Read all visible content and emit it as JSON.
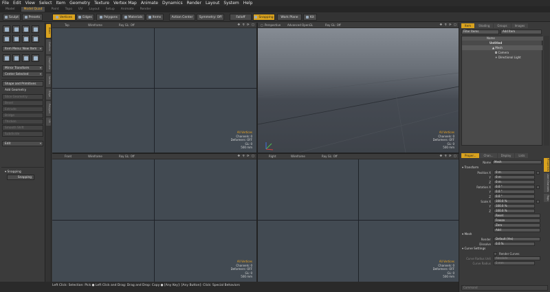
{
  "menu": [
    "File",
    "Edit",
    "View",
    "Select",
    "Item",
    "Geometry",
    "Texture",
    "Vertex Map",
    "Animate",
    "Dynamics",
    "Render",
    "Layout",
    "System",
    "Help"
  ],
  "layout_tabs": [
    {
      "label": "Model",
      "active": false
    },
    {
      "label": "Model Quad",
      "active": true
    },
    {
      "label": "Paint",
      "active": false
    },
    {
      "label": "Topo",
      "active": false
    },
    {
      "label": "UV",
      "active": false
    },
    {
      "label": "Layout",
      "active": false
    },
    {
      "label": "Setup",
      "active": false
    },
    {
      "label": "Animate",
      "active": false
    },
    {
      "label": "Render",
      "active": false
    }
  ],
  "toolbar": {
    "sculpt": "Sculpt",
    "presets": "Presets",
    "vertices": "Vertices",
    "edges": "Edges",
    "polygons": "Polygons",
    "materials": "Materials",
    "items": "Items",
    "action_center": "Action Center",
    "symmetry": "Symmetry: Off",
    "falloff": "Falloff",
    "snapping": "Snapping",
    "work_plane": "Work Plane",
    "kit": "Kit"
  },
  "left": {
    "tabs": [
      "Basic",
      "Deform",
      "Duplicate",
      "Vertex",
      "Edge",
      "Polygon",
      "UV"
    ],
    "item_menu": "Item Menu: New Item",
    "mirror": "Mirror Transform",
    "center": "Center Selected",
    "shape": "Shape and Primitives",
    "add_geometry": "Add Geometry",
    "tools": [
      "Slice Geometry",
      "Bevel",
      "Extrude",
      "Bridge",
      "Thicken",
      "Smooth Shift",
      "Subdivide"
    ],
    "edit": "Edit",
    "snapping_header": "Snapping",
    "snapping_value": "Snapping"
  },
  "viewports": [
    {
      "name": "Top",
      "mode": "Wireframe",
      "render": "Ray GL: Off"
    },
    {
      "name": "Perspective",
      "mode": "Advanced OpenGL",
      "render": "Ray GL: Off"
    },
    {
      "name": "Front",
      "mode": "Wireframe",
      "render": "Ray GL: Off"
    },
    {
      "name": "Right",
      "mode": "Wireframe",
      "render": "Ray GL: Off"
    }
  ],
  "viewport_info": {
    "all": "All Vertices",
    "channels": "Channels: 0",
    "deformers": "Deformers: OFF",
    "gl": "GL: 0",
    "size": "500 mm"
  },
  "viewport_controls": "✥ ⚲ ⟳ ▢",
  "status": "Left Click: Selection: Pick ● Left Click and Drag: Drag and Drop: Copy ● [Any Key]: [Any Button]: Click: Special Behaviors",
  "right": {
    "top_tabs": [
      "Item",
      "Shading",
      "Groups",
      "Images"
    ],
    "filter": "Filter Items",
    "add_item": "Add Item",
    "name_col": "Name",
    "tree": [
      "Untitled",
      "Mesh",
      "Camera",
      "Directional Light"
    ],
    "props_tabs": [
      "Proper...",
      "Chan...",
      "Display",
      "Lists"
    ],
    "name_label": "Name",
    "name_value": "Mesh",
    "transform_header": "Transform",
    "position_label": "Position X",
    "rotation_label": "Rotation X",
    "scale_label": "Scale X",
    "y_label": "Y",
    "z_label": "Z",
    "pos": [
      "0 m",
      "0 m",
      "0 m"
    ],
    "rot": [
      "0.0 °",
      "0.0 °",
      "0.0 °"
    ],
    "scale": [
      "100.0 %",
      "100.0 %",
      "100.0 %"
    ],
    "ops": [
      "Reset",
      "Freeze",
      "Zero",
      "Add"
    ],
    "mesh_header": "Mesh",
    "render_label": "Render",
    "render_value": "Default (Yes)",
    "dissolve_label": "Dissolve",
    "dissolve_value": "0.0 %",
    "curve_header": "Curve Settings",
    "render_curves": "Render Curves",
    "curve_radius_unit": "Curve Radius Unit",
    "curve_radius_unit_value": "Absolute",
    "curve_radius": "Curve Radius",
    "curve_radius_value": "5 mm",
    "side_tabs": [
      "Properties",
      "User Channels",
      "Tags"
    ],
    "command": "Command"
  }
}
